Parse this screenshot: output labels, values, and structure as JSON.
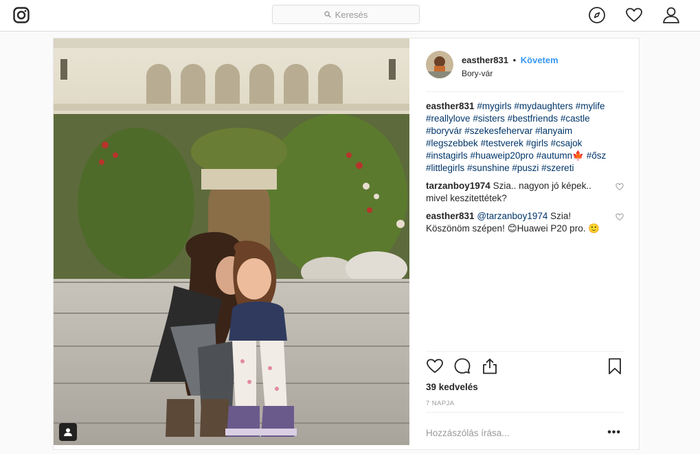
{
  "search": {
    "placeholder": "Keresés"
  },
  "post": {
    "username": "easther831",
    "separator": "•",
    "follow_label": "Követem",
    "location": "Bory-vár",
    "caption": {
      "author": "easther831",
      "text_parts": [
        "#mygirls",
        " ",
        "#mydaughters",
        " ",
        "#mylife",
        " ",
        "#reallylove",
        " ",
        "#sisters",
        " ",
        "#bestfriends",
        " ",
        "#castle",
        " ",
        "#boryvár",
        " ",
        "#szekesfehervar",
        " ",
        "#lanyaim",
        " ",
        "#legszebbek",
        " ",
        "#testverek",
        " ",
        "#girls",
        " ",
        "#csajok",
        " ",
        "#instagirls",
        " ",
        "#huaweip20pro",
        " ",
        "#autumn",
        "🍁 ",
        "#ősz",
        " ",
        "#littlegirls",
        " ",
        "#sunshine",
        " ",
        "#puszi",
        " ",
        "#szereti"
      ]
    },
    "comments": [
      {
        "author": "tarzanboy1974",
        "text": "Szia.. nagyon jó képek.. mivel keszitettétek?"
      },
      {
        "author": "easther831",
        "mention": "@tarzanboy1974",
        "text": "Szia! Köszönöm szépen! 😊Huawei P20 pro. 🙂"
      }
    ],
    "likes_text": "39 kedvelés",
    "time_ago": "7 NAPJA",
    "add_comment_placeholder": "Hozzászólás írása...",
    "more_options": "•••"
  },
  "colors": {
    "link_blue": "#3897f0",
    "hashtag": "#003569",
    "border": "#dbdbdb"
  }
}
